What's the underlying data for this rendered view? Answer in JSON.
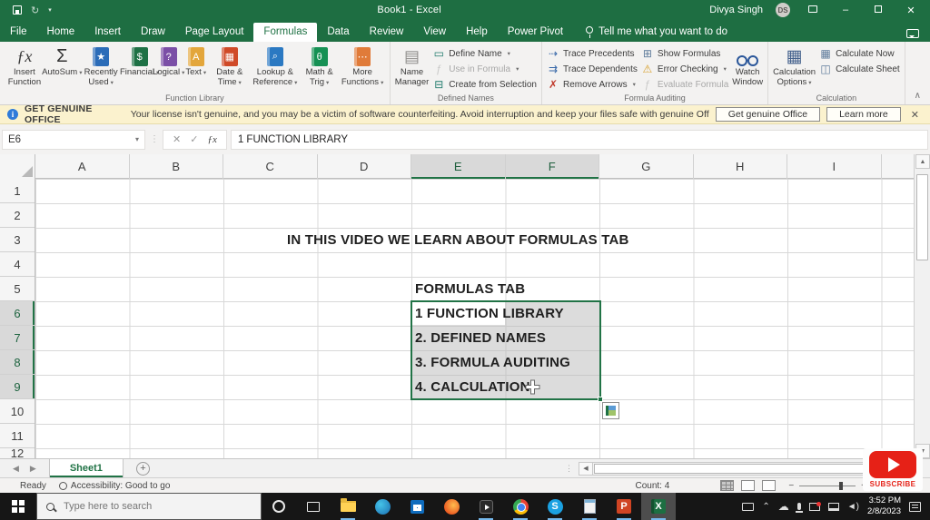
{
  "colors": {
    "excel_green": "#1e6e42",
    "accent_green": "#217346",
    "ribbon_bg": "#f3f2f1",
    "warning_bg": "#fbf2ce",
    "selection_fill": "#dcdcdc",
    "taskbar_bg": "#161616",
    "subscribe_red": "#e62117"
  },
  "titlebar": {
    "title": "Book1 - Excel",
    "user_name": "Divya Singh",
    "user_initials": "DS"
  },
  "ribbon_tabs": {
    "items": [
      "File",
      "Home",
      "Insert",
      "Draw",
      "Page Layout",
      "Formulas",
      "Data",
      "Review",
      "View",
      "Help",
      "Power Pivot"
    ],
    "active": "Formulas",
    "tell_me": "Tell me what you want to do"
  },
  "ribbon": {
    "groups": [
      {
        "label": "Function Library",
        "items": [
          {
            "type": "big",
            "name": "insert-function",
            "icon": "fx-icon",
            "label": "Insert Function"
          },
          {
            "type": "big",
            "name": "autosum",
            "icon": "sigma-icon",
            "label": "AutoSum",
            "dropdown": true
          },
          {
            "type": "big",
            "name": "recently-used",
            "icon": "book-star-icon",
            "label": "Recently Used",
            "dropdown": true
          },
          {
            "type": "big",
            "name": "financial",
            "icon": "book-financial-icon",
            "label": "Financial",
            "dropdown": true
          },
          {
            "type": "big",
            "name": "logical",
            "icon": "book-logical-icon",
            "label": "Logical",
            "dropdown": true
          },
          {
            "type": "big",
            "name": "text",
            "icon": "book-text-icon",
            "label": "Text",
            "dropdown": true
          },
          {
            "type": "big",
            "name": "date-time",
            "icon": "book-datetime-icon",
            "label": "Date & Time",
            "dropdown": true
          },
          {
            "type": "big",
            "name": "lookup-reference",
            "icon": "book-lookup-icon",
            "label": "Lookup & Reference",
            "dropdown": true
          },
          {
            "type": "big",
            "name": "math-trig",
            "icon": "book-math-icon",
            "label": "Math & Trig",
            "dropdown": true
          },
          {
            "type": "big",
            "name": "more-functions",
            "icon": "book-more-icon",
            "label": "More Functions",
            "dropdown": true
          }
        ]
      },
      {
        "label": "Defined Names",
        "items": [
          {
            "type": "big",
            "name": "name-manager",
            "icon": "name-manager-icon",
            "label": "Name Manager"
          },
          {
            "type": "stack",
            "buttons": [
              {
                "name": "define-name",
                "icon": "define-name-icon",
                "label": "Define Name",
                "dropdown": true
              },
              {
                "name": "use-in-formula",
                "icon": "use-in-formula-icon",
                "label": "Use in Formula",
                "dropdown": true,
                "disabled": true
              },
              {
                "name": "create-from-selection",
                "icon": "create-from-selection-icon",
                "label": "Create from Selection"
              }
            ]
          }
        ]
      },
      {
        "label": "Formula Auditing",
        "items": [
          {
            "type": "stack",
            "buttons": [
              {
                "name": "trace-precedents",
                "icon": "trace-precedents-icon",
                "label": "Trace Precedents"
              },
              {
                "name": "trace-dependents",
                "icon": "trace-dependents-icon",
                "label": "Trace Dependents"
              },
              {
                "name": "remove-arrows",
                "icon": "remove-arrows-icon",
                "label": "Remove Arrows",
                "dropdown": true
              }
            ]
          },
          {
            "type": "stack",
            "buttons": [
              {
                "name": "show-formulas",
                "icon": "show-formulas-icon",
                "label": "Show Formulas"
              },
              {
                "name": "error-checking",
                "icon": "error-checking-icon",
                "label": "Error Checking",
                "dropdown": true
              },
              {
                "name": "evaluate-formula",
                "icon": "evaluate-formula-icon",
                "label": "Evaluate Formula",
                "disabled": true
              }
            ]
          },
          {
            "type": "big",
            "name": "watch-window",
            "icon": "watch-window-icon",
            "label": "Watch Window"
          }
        ]
      },
      {
        "label": "Calculation",
        "items": [
          {
            "type": "big",
            "name": "calculation-options",
            "icon": "calc-options-icon",
            "label": "Calculation Options",
            "dropdown": true
          },
          {
            "type": "stack",
            "buttons": [
              {
                "name": "calculate-now",
                "icon": "calculate-now-icon",
                "label": "Calculate Now"
              },
              {
                "name": "calculate-sheet",
                "icon": "calculate-sheet-icon",
                "label": "Calculate Sheet"
              }
            ]
          }
        ]
      }
    ]
  },
  "warning_bar": {
    "title": "GET GENUINE OFFICE",
    "message": "Your license isn't genuine, and you may be a victim of software counterfeiting. Avoid interruption and keep your files safe with genuine Office today.",
    "buttons": [
      "Get genuine Office",
      "Learn more"
    ]
  },
  "formula_bar": {
    "name_box": "E6",
    "content": "1 FUNCTION LIBRARY"
  },
  "grid": {
    "column_headers": [
      "A",
      "B",
      "C",
      "D",
      "E",
      "F",
      "G",
      "H",
      "I"
    ],
    "selected_columns": [
      "E",
      "F"
    ],
    "row_headers": [
      "1",
      "2",
      "3",
      "4",
      "5",
      "6",
      "7",
      "8",
      "9",
      "10",
      "11",
      "12"
    ],
    "selected_rows": [
      "6",
      "7",
      "8",
      "9"
    ],
    "active_cell": "E6",
    "selection_range": "E6:F9",
    "cells": {
      "banner_row3": "IN THIS VIDEO WE LEARN ABOUT FORMULAS TAB",
      "e5": "FORMULAS TAB",
      "e6": "1 FUNCTION LIBRARY",
      "e7": "2. DEFINED NAMES",
      "e8": "3. FORMULA AUDITING",
      "e9": "4. CALCULATION"
    }
  },
  "sheet_bar": {
    "active_tab": "Sheet1"
  },
  "status_bar": {
    "mode": "Ready",
    "accessibility": "Accessibility: Good to go",
    "count": "Count: 4"
  },
  "taskbar": {
    "search_placeholder": "Type here to search",
    "apps": [
      {
        "name": "cortana",
        "running": false,
        "active": false
      },
      {
        "name": "task-view",
        "running": false,
        "active": false
      },
      {
        "name": "file-explorer",
        "running": true,
        "active": false
      },
      {
        "name": "edge",
        "running": false,
        "active": false
      },
      {
        "name": "store",
        "running": false,
        "active": false
      },
      {
        "name": "firefox",
        "running": false,
        "active": false
      },
      {
        "name": "phone",
        "running": true,
        "active": false
      },
      {
        "name": "chrome",
        "running": true,
        "active": false
      },
      {
        "name": "skype",
        "running": true,
        "active": false
      },
      {
        "name": "notepad",
        "running": true,
        "active": false
      },
      {
        "name": "powerpoint",
        "running": true,
        "active": false
      },
      {
        "name": "excel",
        "running": true,
        "active": true
      }
    ],
    "app_glyphs": {
      "skype": "S",
      "powerpoint": "P",
      "excel": "X"
    },
    "clock_time": "3:52 PM",
    "clock_date": "2/8/2023"
  },
  "overlay": {
    "subscribe_label": "SUBSCRIBE"
  }
}
